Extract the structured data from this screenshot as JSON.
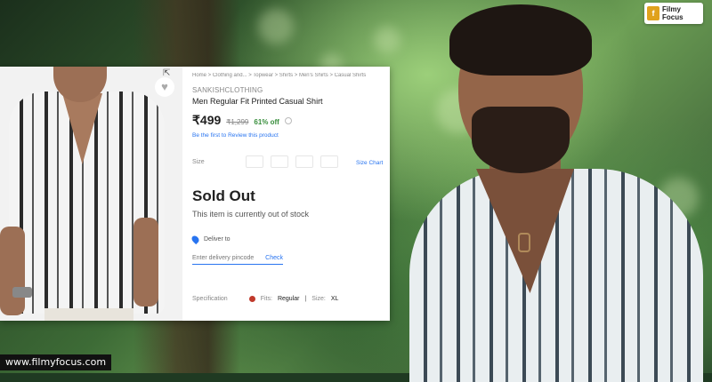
{
  "breadcrumb": "Home  >  Clothing and...  >  Topwear  >  Shirts  >  Men's Shirts  >  Casual Shirts",
  "product": {
    "brand": "SANKISHCLOTHING",
    "title": "Men Regular Fit Printed Casual Shirt",
    "price": "₹499",
    "mrp": "₹1,299",
    "discount": "61% off",
    "review_link": "Be the first to Review this product"
  },
  "size": {
    "label": "Size",
    "chart_link": "Size Chart"
  },
  "availability": {
    "status": "Sold Out",
    "message": "This item is currently out of stock"
  },
  "delivery": {
    "label": "Deliver to",
    "pincode_placeholder": "Enter delivery pincode",
    "check_label": "Check"
  },
  "specification": {
    "label": "Specification",
    "fits_label": "Fits:",
    "fits_value": "Regular",
    "size_label": "Size:",
    "size_value": "XL"
  },
  "logo": {
    "line1": "Filmy",
    "line2": "Focus"
  },
  "watermark": "www.filmyfocus.com",
  "icons": {
    "wishlist": "heart-icon",
    "share": "share-icon",
    "location": "location-pin-icon",
    "info": "info-icon"
  }
}
